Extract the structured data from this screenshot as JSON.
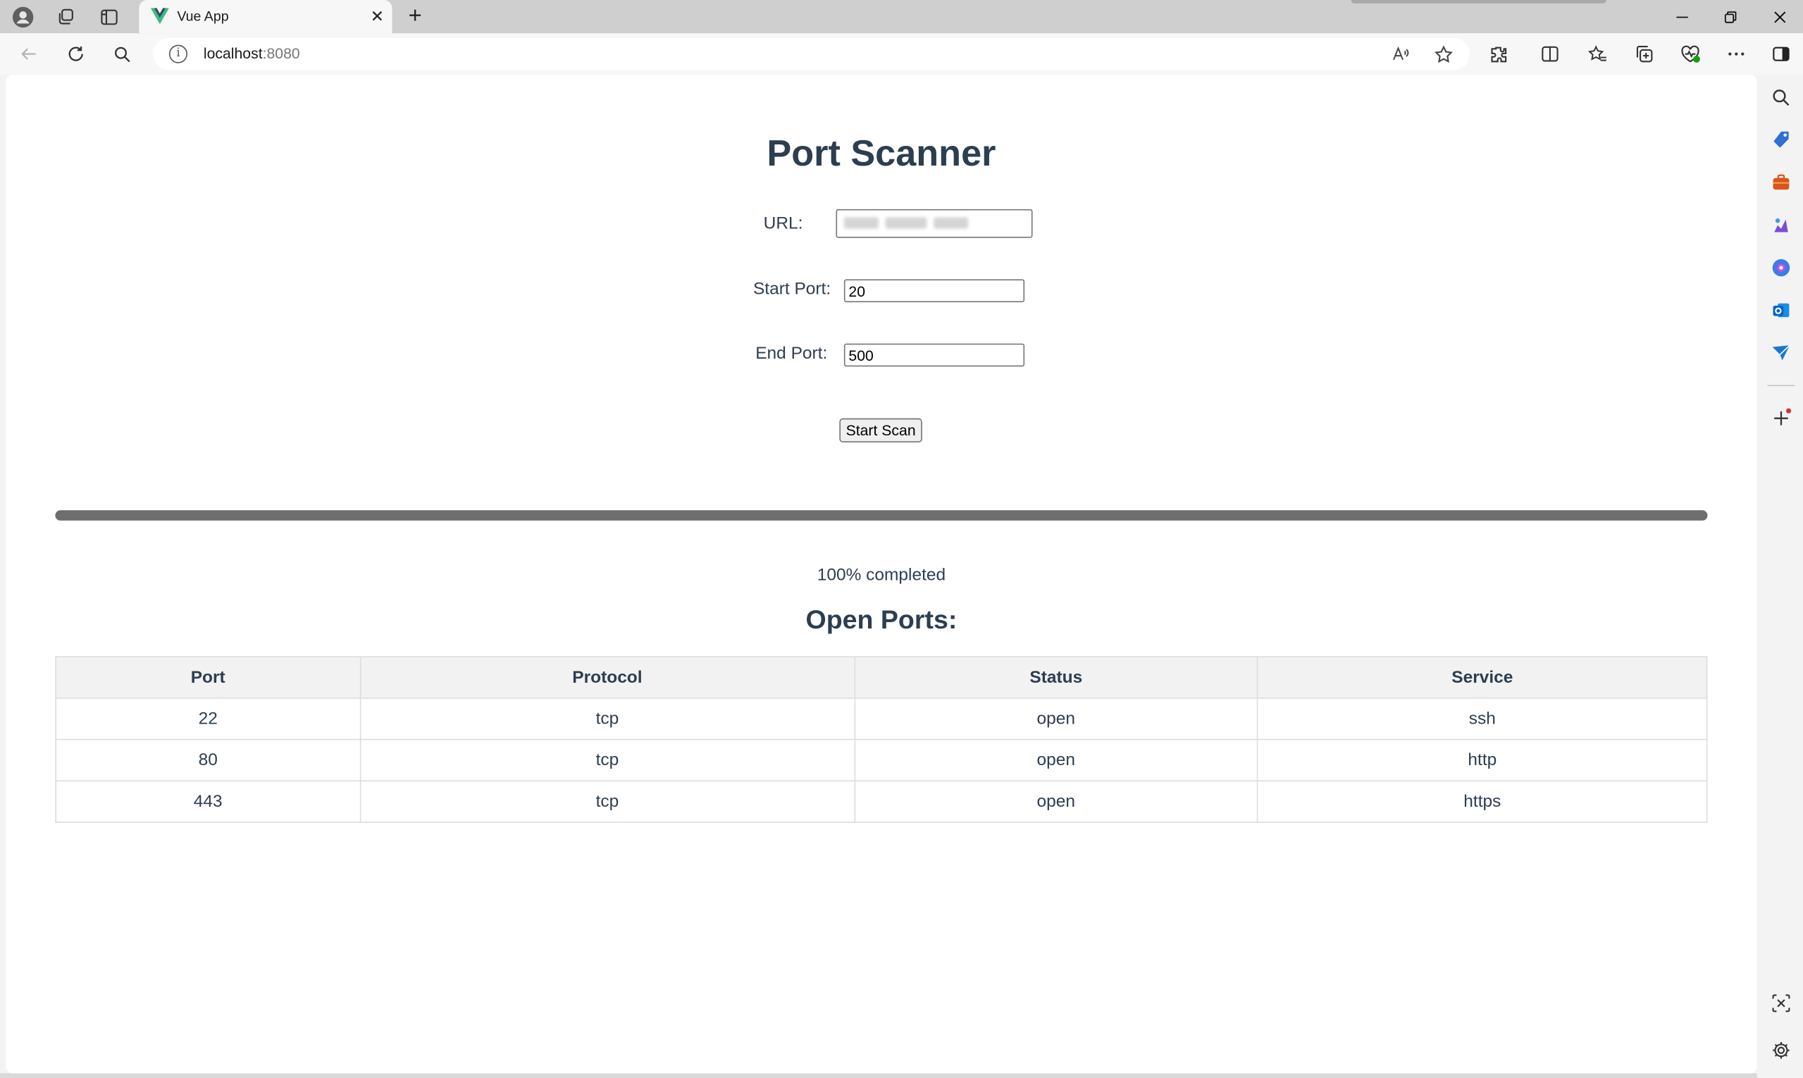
{
  "browser": {
    "tab_title": "Vue App",
    "address": {
      "host": "localhost",
      "port": ":8080"
    },
    "icons": {
      "tabstrip": [
        "profile-icon",
        "workspaces-icon",
        "vertical-tabs-icon"
      ],
      "toolbar": [
        "back-icon",
        "refresh-icon",
        "search-icon",
        "site-info-icon",
        "read-aloud-icon",
        "favorite-star-icon",
        "extensions-icon",
        "split-screen-icon",
        "favorites-icon",
        "collections-icon",
        "browser-essentials-icon",
        "more-icon",
        "sidebar-toggle-icon"
      ],
      "sidebar": [
        "search-icon",
        "shopping-tag-icon",
        "tools-icon",
        "games-icon",
        "copilot-icon",
        "outlook-icon",
        "send-icon",
        "add-icon",
        "screenshot-icon",
        "settings-icon"
      ]
    }
  },
  "page": {
    "title": "Port Scanner",
    "form": {
      "url_label": "URL:",
      "start_label": "Start Port:",
      "start_value": "20",
      "end_label": "End Port:",
      "end_value": "500",
      "scan_button": "Start Scan"
    },
    "progress": {
      "percent": 100,
      "text": "100% completed"
    },
    "results_title": "Open Ports:",
    "table": {
      "headers": {
        "port": "Port",
        "protocol": "Protocol",
        "status": "Status",
        "service": "Service"
      },
      "rows": [
        {
          "port": "22",
          "protocol": "tcp",
          "status": "open",
          "service": "ssh"
        },
        {
          "port": "80",
          "protocol": "tcp",
          "status": "open",
          "service": "http"
        },
        {
          "port": "443",
          "protocol": "tcp",
          "status": "open",
          "service": "https"
        }
      ]
    }
  },
  "colors": {
    "heading": "#2c3e50",
    "progress_fill": "#6e6e6e",
    "vue_green": "#41b883",
    "vue_dark": "#34495e"
  }
}
